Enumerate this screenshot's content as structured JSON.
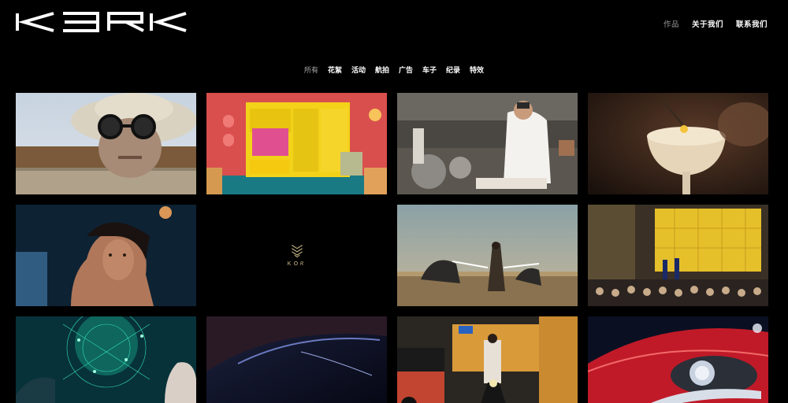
{
  "header": {
    "logo": "KERK",
    "nav": [
      {
        "label": "作品",
        "active": true
      },
      {
        "label": "关于我们",
        "active": false
      },
      {
        "label": "联系我们",
        "active": false
      }
    ]
  },
  "filters": [
    {
      "label": "所有",
      "active": true
    },
    {
      "label": "花絮",
      "active": false
    },
    {
      "label": "活动",
      "active": false
    },
    {
      "label": "航拍",
      "active": false
    },
    {
      "label": "广告",
      "active": false
    },
    {
      "label": "车子",
      "active": false
    },
    {
      "label": "纪录",
      "active": false
    },
    {
      "label": "特效",
      "active": false
    }
  ],
  "grid": {
    "kor_label": "ᏦOᖇ",
    "tiles": [
      {
        "name": "old-man-hat"
      },
      {
        "name": "yellow-closet-room"
      },
      {
        "name": "chef-kitchen"
      },
      {
        "name": "cocktail-glass"
      },
      {
        "name": "woman-portrait-blue"
      },
      {
        "name": "kor-logo"
      },
      {
        "name": "desert-lightsaber"
      },
      {
        "name": "concert-crowd"
      },
      {
        "name": "hologram-map"
      },
      {
        "name": "car-hood-dark"
      },
      {
        "name": "motorcycle-rider-garage"
      },
      {
        "name": "red-car-headlight"
      }
    ]
  },
  "colors": {
    "background": "#000000",
    "nav_active": "#9a9a9a",
    "kor_gold": "#c9b784"
  }
}
